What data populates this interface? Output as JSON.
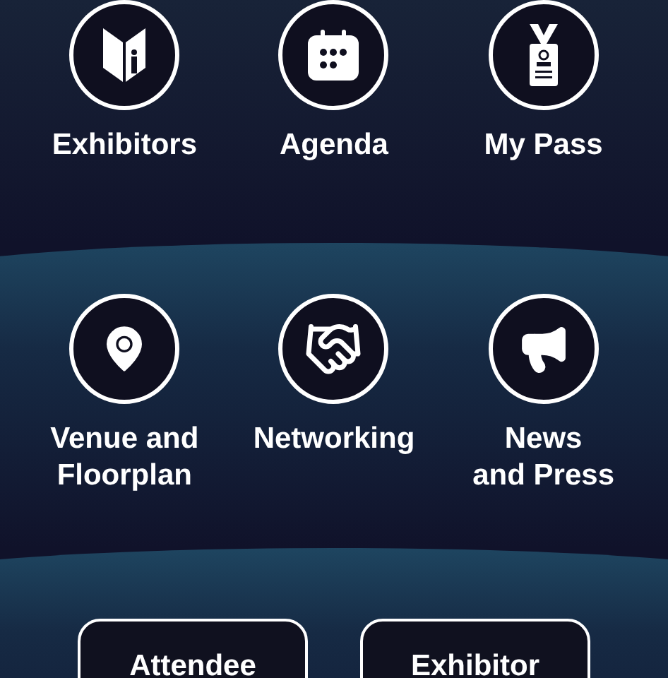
{
  "sections": [
    {
      "tiles": [
        {
          "label": "Exhibitors"
        },
        {
          "label": "Agenda"
        },
        {
          "label": "My Pass"
        }
      ]
    },
    {
      "tiles": [
        {
          "label": "Venue and\nFloorplan"
        },
        {
          "label": "Networking"
        },
        {
          "label": "News\nand Press"
        }
      ]
    }
  ],
  "buttons": [
    "Attendee",
    "Exhibitor"
  ]
}
